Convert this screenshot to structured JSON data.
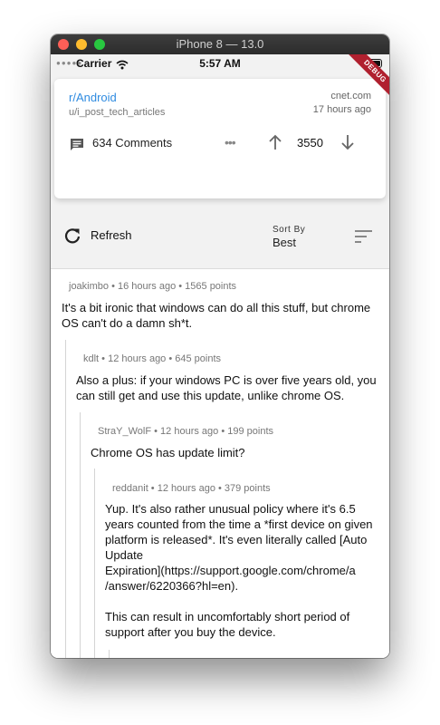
{
  "window": {
    "title": "iPhone 8 — 13.0"
  },
  "status_bar": {
    "carrier": "Carrier",
    "time": "5:57 AM"
  },
  "debug_banner": "DEBUG",
  "post": {
    "subreddit": "r/Android",
    "author": "u/i_post_tech_articles",
    "domain": "cnet.com",
    "age": "17 hours ago",
    "comments": "634 Comments",
    "more": "•••",
    "score": "3550"
  },
  "toolbar": {
    "refresh_label": "Refresh",
    "sort_caption": "Sort By",
    "sort_value": "Best"
  },
  "comments": [
    {
      "meta": "joakimbo • 16 hours ago • 1565 points",
      "lines": [
        "It's a bit ironic that windows can do all this stuff, but chrome",
        "OS can't do a damn sh*t."
      ]
    },
    {
      "meta": "kdlt • 12 hours ago • 645 points",
      "lines": [
        "Also a plus: if your windows PC is over five years old, you",
        "can still get and use this update, unlike chrome OS."
      ]
    },
    {
      "meta": "StraY_WolF • 12 hours ago • 199 points",
      "lines": [
        "Chrome OS has update limit?"
      ]
    },
    {
      "meta": "reddanit • 12 hours ago • 379 points",
      "lines": [
        "Yup. It's also rather unusual policy where it's 6.5",
        "years counted from the time a *first device on given",
        "platform is released*. It's even literally called [Auto",
        "Update",
        "Expiration](https://support.google.com/chrome/a",
        "/answer/6220366?hl=en).",
        "",
        "This can result in uncomfortably short period of",
        "support after you buy the device."
      ]
    }
  ]
}
